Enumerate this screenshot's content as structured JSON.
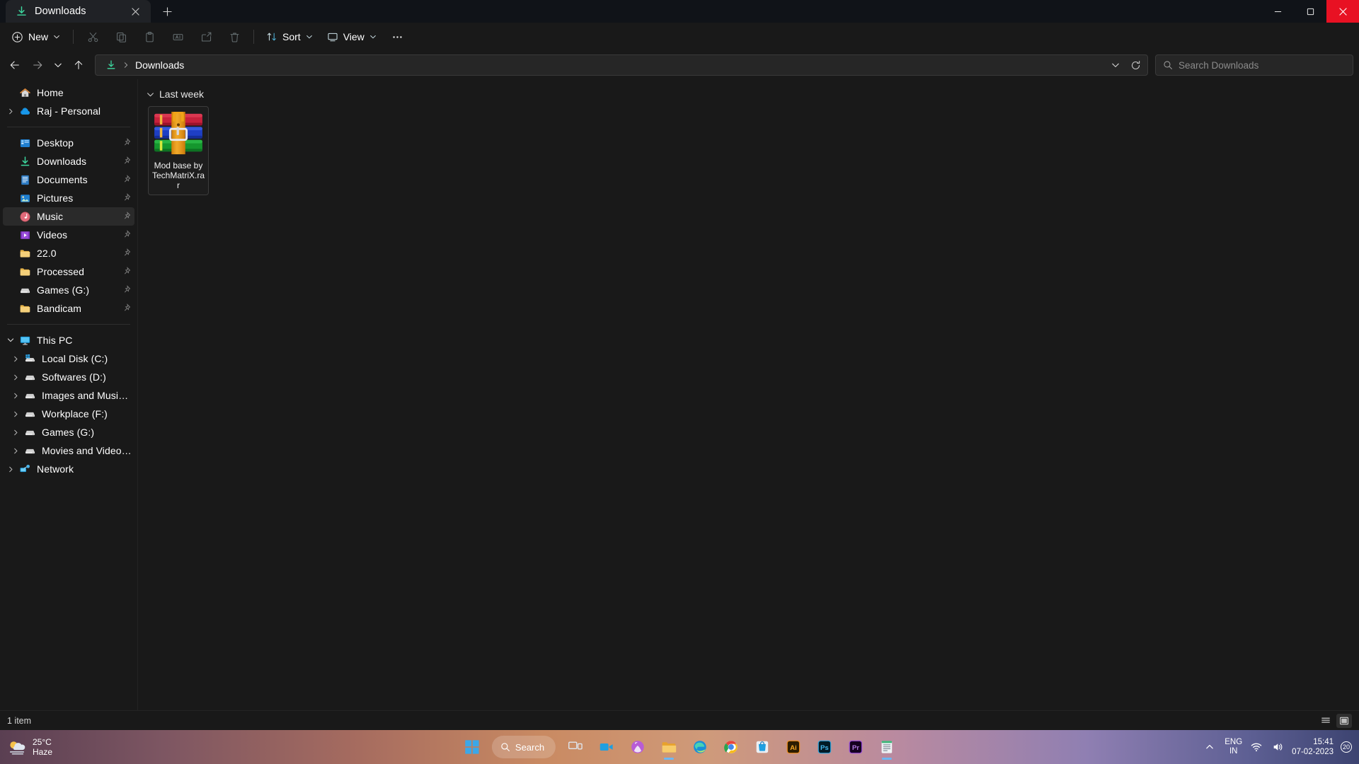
{
  "window": {
    "tab": {
      "label": "Downloads",
      "icon": "downloads-icon",
      "close_label": "Close tab"
    },
    "new_tab_label": "+",
    "controls": {
      "minimize": "Minimize",
      "maximize": "Maximize",
      "close": "Close"
    },
    "close_color": "#e81123"
  },
  "toolbar": {
    "new_label": "New",
    "sort_label": "Sort",
    "view_label": "View",
    "more_label": "See more",
    "icons": [
      "cut-icon",
      "copy-icon",
      "paste-icon",
      "rename-icon",
      "share-icon",
      "delete-icon"
    ]
  },
  "addressbar": {
    "back": "Back",
    "forward": "Forward",
    "recent": "Recent locations",
    "up": "Up to Home",
    "path_icon": "downloads-icon",
    "path": "Downloads",
    "history_label": "Previous locations",
    "refresh_label": "Refresh"
  },
  "search": {
    "placeholder": "Search Downloads",
    "icon": "search-icon"
  },
  "sidebar": {
    "groups": [
      {
        "items": [
          {
            "label": "Home",
            "icon": "home-icon",
            "chevron": false,
            "pin": false,
            "indent": 0
          },
          {
            "label": "Raj - Personal",
            "icon": "onedrive-icon",
            "chevron": "right",
            "pin": false,
            "indent": 0
          }
        ]
      },
      {
        "items": [
          {
            "label": "Desktop",
            "icon": "desktop-icon",
            "chevron": false,
            "pin": true,
            "indent": 1
          },
          {
            "label": "Downloads",
            "icon": "downloads-icon",
            "chevron": false,
            "pin": true,
            "indent": 1
          },
          {
            "label": "Documents",
            "icon": "documents-icon",
            "chevron": false,
            "pin": true,
            "indent": 1
          },
          {
            "label": "Pictures",
            "icon": "pictures-icon",
            "chevron": false,
            "pin": true,
            "indent": 1
          },
          {
            "label": "Music",
            "icon": "music-icon",
            "chevron": false,
            "pin": true,
            "indent": 1,
            "highlight": true
          },
          {
            "label": "Videos",
            "icon": "videos-icon",
            "chevron": false,
            "pin": true,
            "indent": 1
          },
          {
            "label": "22.0",
            "icon": "folder-icon",
            "chevron": false,
            "pin": true,
            "indent": 1
          },
          {
            "label": "Processed",
            "icon": "folder-icon",
            "chevron": false,
            "pin": true,
            "indent": 1
          },
          {
            "label": "Games (G:)",
            "icon": "drive-icon",
            "chevron": false,
            "pin": true,
            "indent": 1
          },
          {
            "label": "Bandicam",
            "icon": "folder-icon",
            "chevron": false,
            "pin": true,
            "indent": 1
          }
        ]
      },
      {
        "items": [
          {
            "label": "This PC",
            "icon": "thispc-icon",
            "chevron": "down",
            "pin": false,
            "indent": 0
          },
          {
            "label": "Local Disk (C:)",
            "icon": "windows-drive-icon",
            "chevron": "right",
            "pin": false,
            "indent": 1
          },
          {
            "label": "Softwares (D:)",
            "icon": "drive-icon",
            "chevron": "right",
            "pin": false,
            "indent": 1
          },
          {
            "label": "Images and Music (E:)",
            "icon": "drive-icon",
            "chevron": "right",
            "pin": false,
            "indent": 1
          },
          {
            "label": "Workplace (F:)",
            "icon": "drive-icon",
            "chevron": "right",
            "pin": false,
            "indent": 1
          },
          {
            "label": "Games (G:)",
            "icon": "drive-icon",
            "chevron": "right",
            "pin": false,
            "indent": 1
          },
          {
            "label": "Movies and Videos (H:)",
            "icon": "drive-icon",
            "chevron": "right",
            "pin": false,
            "indent": 1
          },
          {
            "label": "Network",
            "icon": "network-icon",
            "chevron": "right",
            "pin": false,
            "indent": 0
          }
        ]
      }
    ]
  },
  "content": {
    "group_header": "Last week",
    "files": [
      {
        "name": "Mod base by TechMatriX.rar",
        "icon": "winrar-archive-icon",
        "selected": true
      }
    ]
  },
  "statusbar": {
    "count": "1 item",
    "details_view": "details-view-icon",
    "large_icons_view": "large-icons-view-icon"
  },
  "taskbar": {
    "weather": {
      "temp": "25°C",
      "condition": "Haze",
      "icon": "haze-icon"
    },
    "start_label": "Start",
    "search_label": "Search",
    "apps": [
      {
        "name": "task-view-icon"
      },
      {
        "name": "camera-icon"
      },
      {
        "name": "xbox-icon"
      },
      {
        "name": "file-explorer-icon",
        "running": true
      },
      {
        "name": "edge-icon"
      },
      {
        "name": "chrome-icon"
      },
      {
        "name": "store-icon"
      },
      {
        "name": "illustrator-icon"
      },
      {
        "name": "photoshop-icon"
      },
      {
        "name": "premiere-icon"
      },
      {
        "name": "notepad-icon"
      }
    ],
    "tray": {
      "overflow": "show-hidden-icons",
      "language": "ENG",
      "region": "IN",
      "wifi": "wifi-icon",
      "volume": "volume-icon",
      "time": "15:41",
      "date": "07-02-2023",
      "notification_count": "20"
    }
  }
}
